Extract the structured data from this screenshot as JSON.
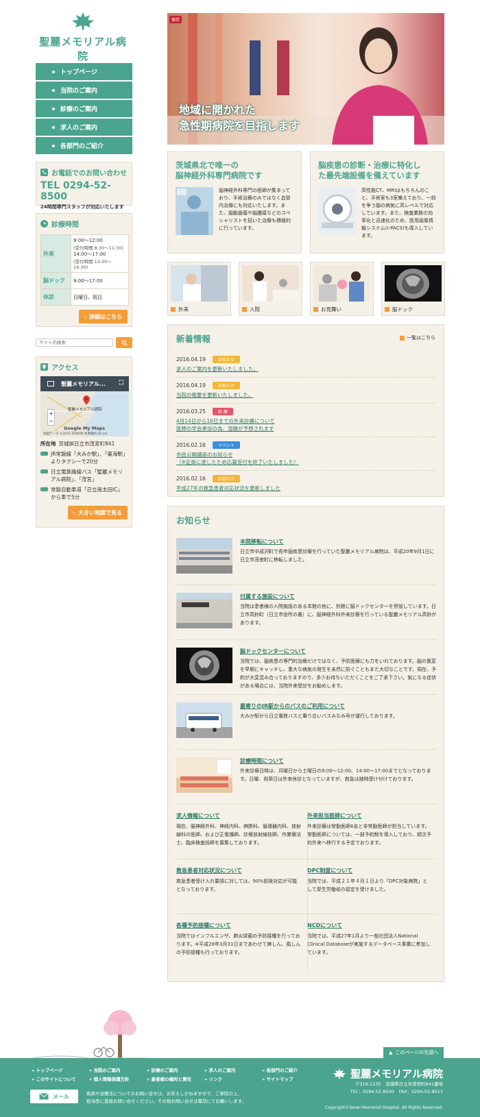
{
  "brand": {
    "name": "聖麗メモリアル病院",
    "accent": "#4aa48e",
    "accent_dark": "#2c7a66",
    "orange": "#f39c3a"
  },
  "nav": [
    "トップページ",
    "当院のご案内",
    "診療のご案内",
    "求人のご案内",
    "各部門のご紹介"
  ],
  "phone": {
    "title": "お電話でのお問い合わせ",
    "number": "TEL 0294-52-8500",
    "note": "24時間専門スタッフが対応いたします"
  },
  "hours": {
    "title": "診療時間",
    "rows": [
      {
        "label": "外来",
        "v1": "9:00〜12:00",
        "n1": "(受付時間 8:30〜11:30)",
        "v2": "14:00〜17:00",
        "n2": "(受付時間 13:00〜16:30)"
      },
      {
        "label": "脳ドック",
        "v1": "9:00〜17:00"
      },
      {
        "label": "休診",
        "v1": "日曜日、祝日"
      }
    ],
    "button": "詳細はこちら"
  },
  "search": {
    "placeholder": "サイト内検索"
  },
  "access": {
    "title": "アクセス",
    "map_title": "聖麗メモリアル...",
    "map_place": "聖麗メモリアル病院",
    "map_footer": "地図データ ©2016 ZENRIN  利用規約  20 km",
    "map_logo": "Google My Maps",
    "address_label": "所在地",
    "address": "茨城県日立市茂宮町841",
    "routes": [
      "JR常磐線「大みか駅」、「東海駅」よりタクシーで20分",
      "日立電鉄路線バス「聖麗メモリアル病院」、「茂宮」",
      "常磐自動車道「日立南太田IC」から車で5分"
    ],
    "button": "大きい地図で見る"
  },
  "hero": {
    "line1": "地域に開かれた",
    "line2": "急性期病院を目指します",
    "badge": "保存"
  },
  "features": [
    {
      "title1": "茨城県北で唯一の",
      "title2": "脳神経外科専門病院です",
      "text": "脳神経外科専門の医師が集まっており、手術治療のみではなく血管内治療にも対応いたします。また、脳動脈瘤や脳腫瘍などのスペシャリストを招いた治療も積極的に行っています。"
    },
    {
      "title1": "脳疾患の診断・治療に特化し",
      "title2": "た最先端設備を備えています",
      "text": "高性能CT、MRIはもちろんのこと、手術室も3室備えており、一刻を争う脳の病気に高レベルで対応しています。また、検査業務の効率化と迅速化のため、医用画像情報システム(I-PACS)も導入しています。"
    }
  ],
  "thumbs": [
    "外来",
    "入院",
    "お見舞い",
    "脳ドック"
  ],
  "news": {
    "title": "新着情報",
    "more": "一覧はこちら",
    "items": [
      {
        "date": "2016.04.19",
        "tag": "お知らせ",
        "tag_color": "#f2b63a",
        "line1": "求人のご案内を更新いたしました。",
        "line2": ""
      },
      {
        "date": "2016.04.19",
        "tag": "お知らせ",
        "tag_color": "#f2b63a",
        "line1": "当院の概要を更新いたしました。",
        "line2": ""
      },
      {
        "date": "2016.03.25",
        "tag": "診 療",
        "tag_color": "#e8546a",
        "line1": "4月14日から16日までの外来診療について",
        "line2": "医師の学会参加の為、混雑が予想されます"
      },
      {
        "date": "2016.02.16",
        "tag": "イベント",
        "tag_color": "#3a8fe0",
        "line1": "市民公開講座のお知らせ",
        "line2": "（※定員に達したため応募受付を終了いたしました）"
      },
      {
        "date": "2016.02.16",
        "tag": "お知らせ",
        "tag_color": "#f2b63a",
        "line1": "平成27年の救急患者対応状況を更新しました",
        "line2": ""
      }
    ]
  },
  "notice": {
    "title": "お知らせ",
    "items": [
      {
        "title": "本院移転について",
        "text": "日立市中成沢町で長年脳疾患診療を行っていた聖麗メモリアル病院は、平成20年9月1日に日立市茂宮町に移転しました。"
      },
      {
        "title": "付属する施設について",
        "text": "当院は患者様の入院施設のある本館の他に、別館に脳ドックセンターを併設しています。日立市高鈴町（日立市役所の裏）に、脳神経外科外来診療を行っている聖麗メモリアル高鈴があります。"
      },
      {
        "title": "脳ドックセンターについて",
        "text": "当院では、脳疾患の専門的治療だけではなく、予防医療にも力をいれております。脳の異変を早期にキャッチし、重大な病気の発生を未然に防ぐこともまた大切なことです。現在、予約が大変混み合っておりますので、多少お待ちいただくことをご了承下さい。気になる症状がある場合には、当院外来受診をお勧めします。"
      },
      {
        "title": "最寄りのJR駅からのバスのご利用について",
        "text": "大みか駅から日立電鉄バスと乗り合いバスみなみ号が運行しております。"
      },
      {
        "title": "診療時間について",
        "text": "外来診療日時は、月曜日から土曜日の9:00〜12:00、14:00〜17:00までとなっております。日曜、祝祭日は外来休診となっていますが、救急は随時受け付けております。"
      }
    ],
    "pairs": [
      {
        "title": "求人情報について",
        "text": "現在、脳神経外科、神経内科、麻酔科、循環器内科、放射線科の医師、および正看護師、診療放射線技師、作業療法士、臨床検査技師を募集しております。"
      },
      {
        "title": "外来担当医師について",
        "text": "外来診療は常勤医師6名と非常勤医師が担当しています。常勤医師については、一部予約制を導入しており、順次予約外来へ移行する予定でおります。"
      },
      {
        "title": "救急患者対応状況について",
        "text": "救急患者受け入れ要請に対しては、90%前後対応が可能となっております。"
      },
      {
        "title": "DPC制度について",
        "text": "当院では、平成２１年４月１日より「DPC対象病院」として厚生労働省の認定を受けました。"
      },
      {
        "title": "各種予防接種について",
        "text": "当院ではインフルエンザ、肺炎球菌の予防接種を行っております。※平成28年3月31日まであわせて麻しん、風しんの予防接種も行っております。"
      },
      {
        "title": "NCDについて",
        "text": "当院では、平成27年1月より一般社団法人National Clinical Databaseが実施するデータベース事業に参加しています。"
      }
    ]
  },
  "footer": {
    "top_button": "このページの先頭へ",
    "links": [
      "トップページ",
      "当院のご案内",
      "診療のご案内",
      "求人のご案内",
      "各部門のご紹介",
      "このサイトについて",
      "個人情報保護方針",
      "患者様の権利と責任",
      "リンク",
      "サイトマップ"
    ],
    "mail": "メール",
    "note1": "疾病や治療法についてのお問い合せは、お答えしかねますので、ご来院の上、",
    "note2": "担当医に直接お問い合せください。その他お問い合せは電話にてお願いします。",
    "postal": "〒319-1235　茨城県日立市茂宮町841番地",
    "contact": "TEL：0294-52-8500　FAX：0294-52-8511",
    "copyright": "Copyright©Seirei Memorial Hospital. All Rights Reserved."
  }
}
